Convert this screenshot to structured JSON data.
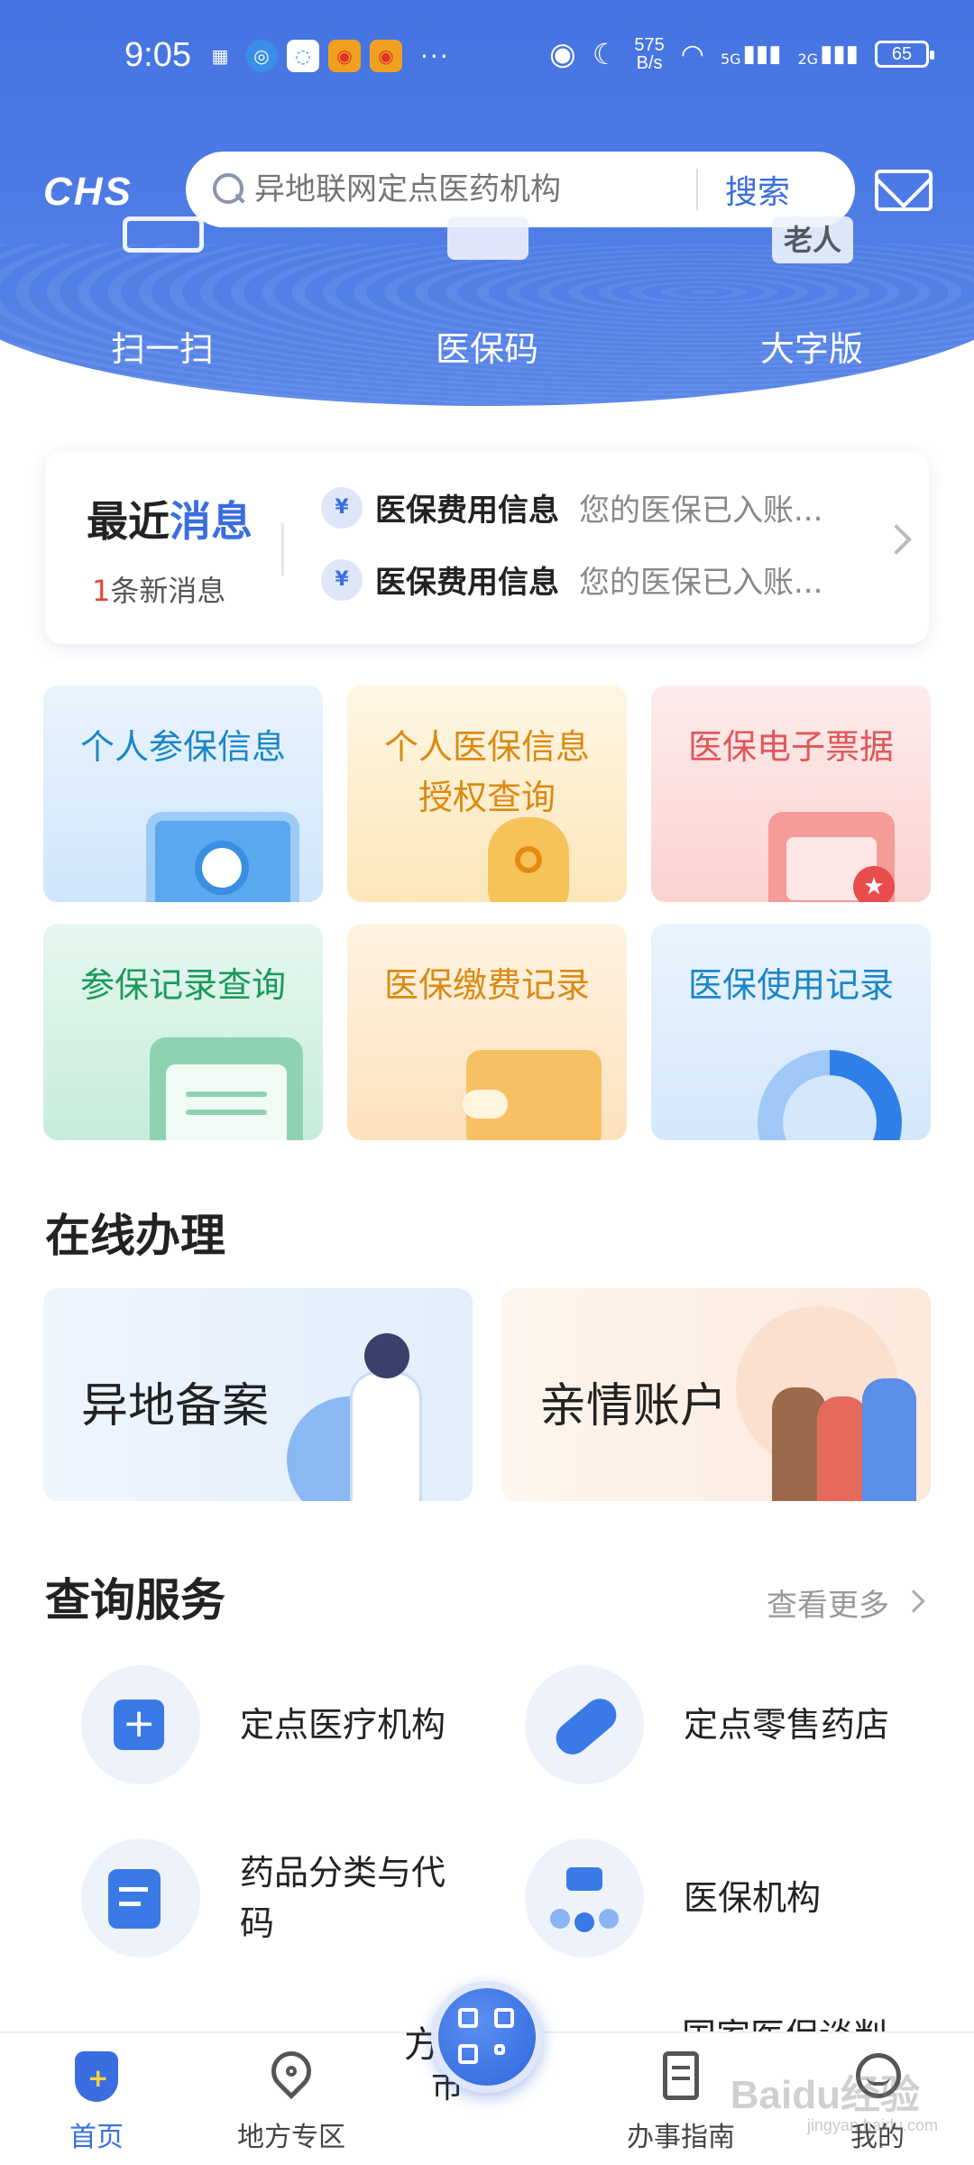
{
  "status_bar": {
    "time": "9:05",
    "net_speed_value": "575",
    "net_speed_unit": "B/s",
    "signal_1": "5G",
    "signal_2": "2G",
    "battery": "65",
    "more_dots": "···"
  },
  "header": {
    "logo_text": "CHS",
    "search_placeholder": "异地联网定点医药机构",
    "search_button": "搜索"
  },
  "quick_actions": [
    {
      "label": "扫一扫",
      "icon": "scan-icon"
    },
    {
      "label": "医保码",
      "icon": "qr-code-icon"
    },
    {
      "label": "大字版",
      "icon": "elderly-mode-icon",
      "icon_text": "老人"
    }
  ],
  "recent_messages": {
    "title_part1": "最近",
    "title_part2": "消息",
    "count": "1",
    "count_suffix": "条新消息",
    "items": [
      {
        "type": "医保费用信息",
        "text": "您的医保已入账..."
      },
      {
        "type": "医保费用信息",
        "text": "您的医保已入账..."
      }
    ]
  },
  "tiles": [
    {
      "label": "个人参保信息",
      "color": "#1a86c8"
    },
    {
      "label": "个人医保信息授权查询",
      "line1": "个人医保信息",
      "line2": "授权查询",
      "color": "#d98a12"
    },
    {
      "label": "医保电子票据",
      "color": "#e0575a"
    },
    {
      "label": "参保记录查询",
      "color": "#1a9a5c"
    },
    {
      "label": "医保缴费记录",
      "color": "#d98a12"
    },
    {
      "label": "医保使用记录",
      "color": "#1a86c8"
    }
  ],
  "online_section": {
    "title": "在线办理",
    "cards": [
      {
        "label": "异地备案"
      },
      {
        "label": "亲情账户"
      }
    ]
  },
  "query_section": {
    "title": "查询服务",
    "more": "查看更多",
    "items": [
      {
        "label": "定点医疗机构",
        "icon": "hospital-icon"
      },
      {
        "label": "定点零售药店",
        "icon": "pill-icon"
      },
      {
        "label": "药品分类与代码",
        "line1": "药品分类与代",
        "line2": "码",
        "icon": "document-icon"
      },
      {
        "label": "医保机构",
        "icon": "org-chart-icon"
      }
    ],
    "peek_right": "国家医保谈判",
    "peek_center": "方",
    "peek_center2": "市"
  },
  "tabbar": {
    "tabs": [
      {
        "label": "首页",
        "icon": "home-shield-icon",
        "active": true
      },
      {
        "label": "地方专区",
        "icon": "location-icon"
      },
      {
        "label": "办事指南",
        "icon": "guide-icon"
      },
      {
        "label": "我的",
        "icon": "profile-icon"
      }
    ]
  },
  "watermark": {
    "text": "Baidu经验",
    "sub": "jingyan.baidu.com"
  },
  "colors": {
    "primary": "#3a6ee0",
    "header_bg": "#4574e2",
    "alert_red": "#e04a3a"
  }
}
